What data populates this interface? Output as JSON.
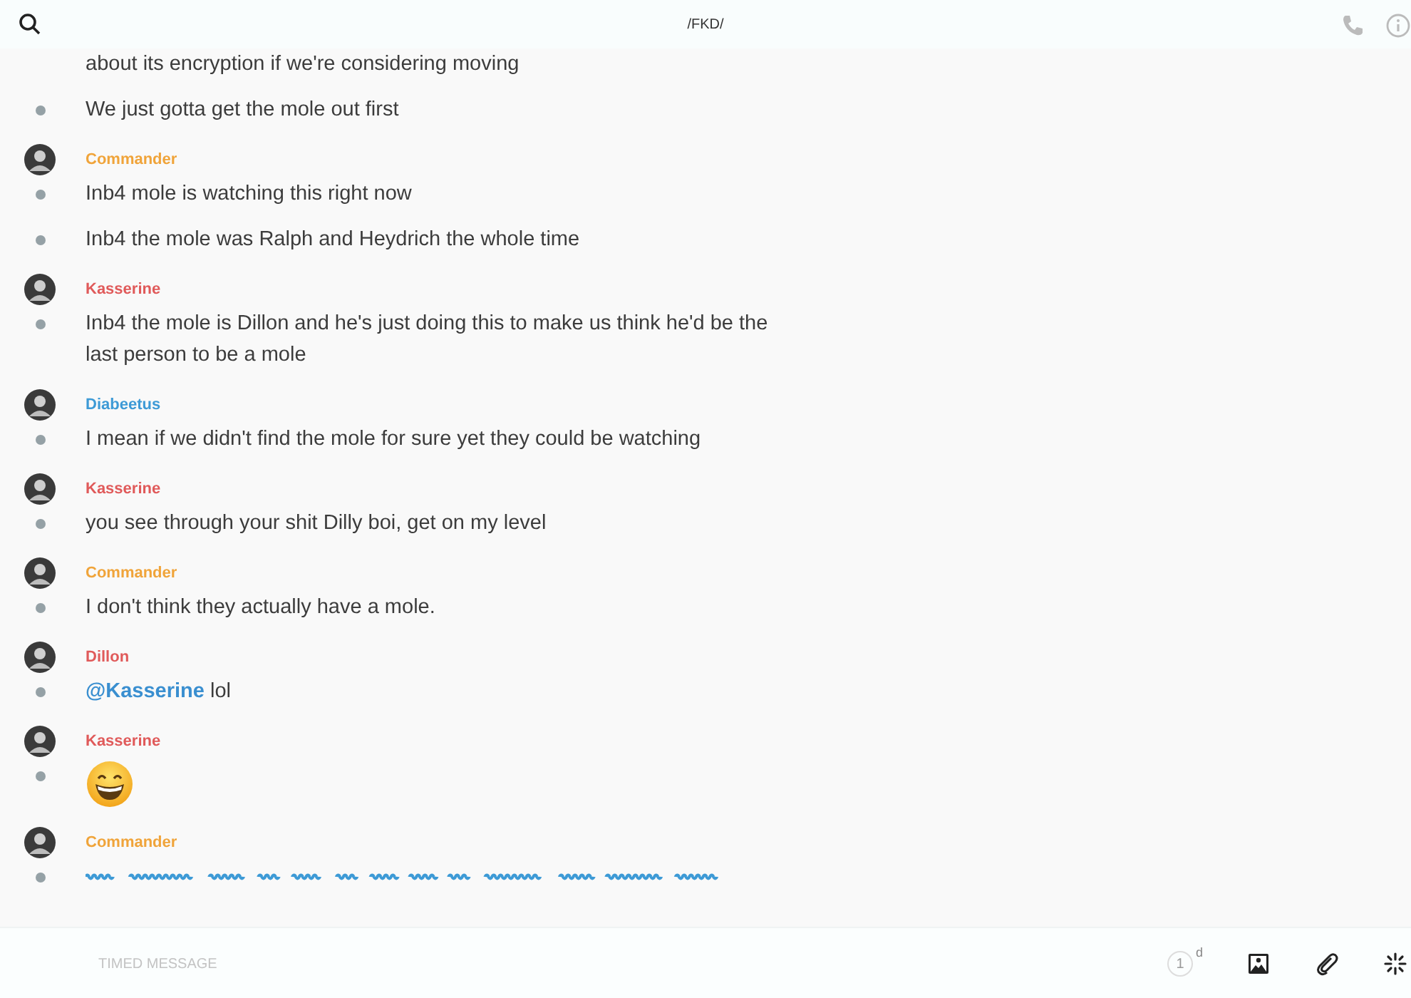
{
  "header": {
    "title": "/FKD/"
  },
  "groups": [
    {
      "messages": [
        {
          "kind": "continuation",
          "text": "about its encryption if we're considering moving"
        },
        {
          "kind": "text",
          "text": "We just gotta get the mole out first"
        }
      ]
    },
    {
      "author": "Commander",
      "color": "#f0a43a",
      "messages": [
        {
          "kind": "text",
          "text": "Inb4 mole is watching this right now"
        },
        {
          "kind": "text",
          "text": "Inb4 the mole was Ralph and Heydrich the whole time"
        }
      ]
    },
    {
      "author": "Kasserine",
      "color": "#e05a5a",
      "messages": [
        {
          "kind": "text",
          "text": "Inb4 the mole is Dillon and he's just doing this to make us think he'd be the last person to be a mole"
        }
      ]
    },
    {
      "author": "Diabeetus",
      "color": "#3d9ad6",
      "messages": [
        {
          "kind": "text",
          "text": "I mean if we didn't find the mole for sure yet they could be watching"
        }
      ]
    },
    {
      "author": "Kasserine",
      "color": "#e05a5a",
      "messages": [
        {
          "kind": "text",
          "text": "you see through your shit Dilly boi, get on my level"
        }
      ]
    },
    {
      "author": "Commander",
      "color": "#f0a43a",
      "messages": [
        {
          "kind": "text",
          "text": "I don't think they actually have a mole."
        }
      ]
    },
    {
      "author": "Dillon",
      "color": "#e05a5a",
      "messages": [
        {
          "kind": "mention",
          "mention": "@Kasserine",
          "text": "lol"
        }
      ]
    },
    {
      "author": "Kasserine",
      "color": "#e05a5a",
      "messages": [
        {
          "kind": "emoji"
        }
      ]
    },
    {
      "author": "Commander",
      "color": "#f0a43a",
      "messages": [
        {
          "kind": "scrambled"
        }
      ]
    }
  ],
  "composer": {
    "placeholder": "TIMED MESSAGE",
    "timer": "1",
    "timer_unit": "d"
  }
}
